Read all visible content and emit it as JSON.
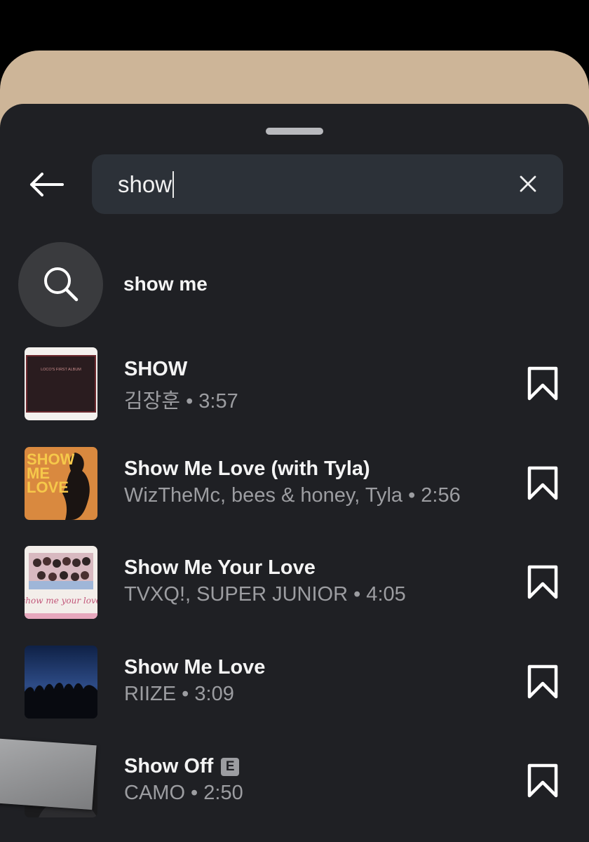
{
  "search": {
    "query": "show"
  },
  "suggestion": {
    "label": "show me",
    "icon": "search-icon"
  },
  "tracks": [
    {
      "title": "SHOW",
      "subtitle": "김장훈 • 3:57",
      "explicit": false,
      "cover_text": "LOCO'S FIRST ALBUM"
    },
    {
      "title": "Show Me Love (with Tyla)",
      "subtitle": "WizTheMc, bees & honey, Tyla • 2:56",
      "explicit": false,
      "cover_text": "SHOW ME LOVE"
    },
    {
      "title": "Show Me Your Love",
      "subtitle": "TVXQ!, SUPER JUNIOR • 4:05",
      "explicit": false,
      "cover_text": "show me your love"
    },
    {
      "title": "Show Me Love",
      "subtitle": "RIIZE • 3:09",
      "explicit": false
    },
    {
      "title": "Show Off",
      "subtitle": "CAMO • 2:50",
      "explicit": true,
      "explicit_label": "E"
    }
  ],
  "colors": {
    "background": "#000000",
    "sheet": "#1f2024",
    "search_bar": "#2c3138",
    "behind_card": "#cdb598",
    "primary_text": "#f4f4f4",
    "secondary_text": "#9c9da1"
  }
}
